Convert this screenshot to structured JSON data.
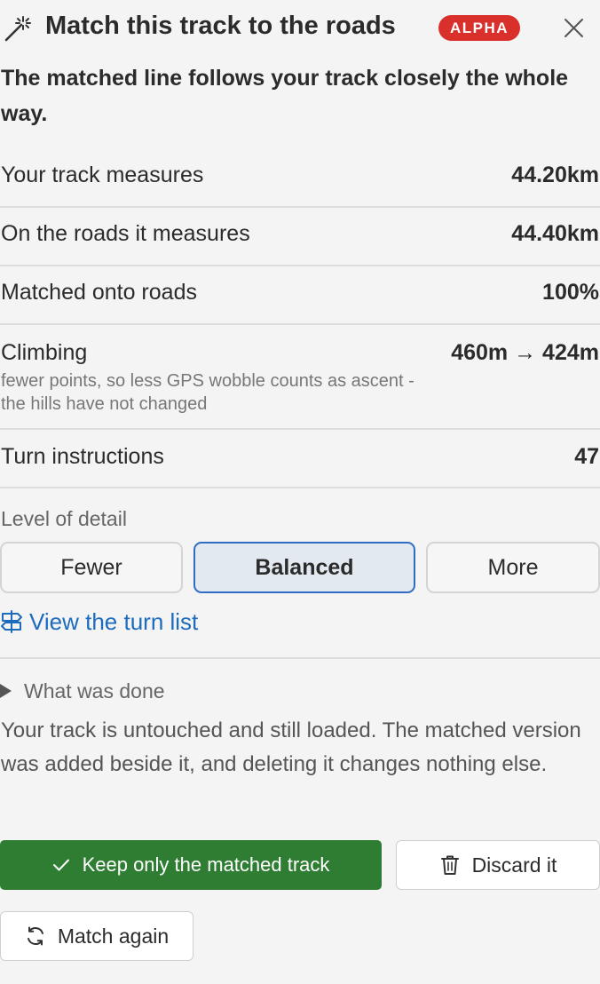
{
  "header": {
    "icon": "magic-wand-icon",
    "title": "Match this track to the roads",
    "badge": "ALPHA",
    "close_icon": "close-icon"
  },
  "summary": "The matched line follows your track closely the whole way.",
  "stats": [
    {
      "label": "Your track measures",
      "value": "44.20km"
    },
    {
      "label": "On the roads it measures",
      "value": "44.40km"
    },
    {
      "label": "Matched onto roads",
      "value": "100%"
    },
    {
      "label": "Climbing",
      "value": "460m → 424m",
      "note": "fewer points, so less GPS wobble counts as ascent - the hills have not changed"
    },
    {
      "label": "Turn instructions",
      "value": "47"
    }
  ],
  "detail": {
    "label": "Level of detail",
    "options": [
      "Fewer",
      "Balanced",
      "More"
    ],
    "selected": "Balanced"
  },
  "turn_list_link": {
    "icon": "signpost-icon",
    "label": "View the turn list"
  },
  "what_was_done": {
    "label": "What was done",
    "text": "Your track is untouched and still loaded. The matched version was added beside it, and deleting it changes nothing else."
  },
  "actions": {
    "keep_label": "Keep only the matched track",
    "keep_icon": "checkmark-icon",
    "discard_label": "Discard it",
    "discard_icon": "trash-icon",
    "rematch_label": "Match again",
    "rematch_icon": "refresh-icon"
  },
  "colors": {
    "badge": "#d9302b",
    "primary_button": "#2e7d32",
    "selected_border": "#2f6cc4",
    "link": "#1d6bbd"
  }
}
